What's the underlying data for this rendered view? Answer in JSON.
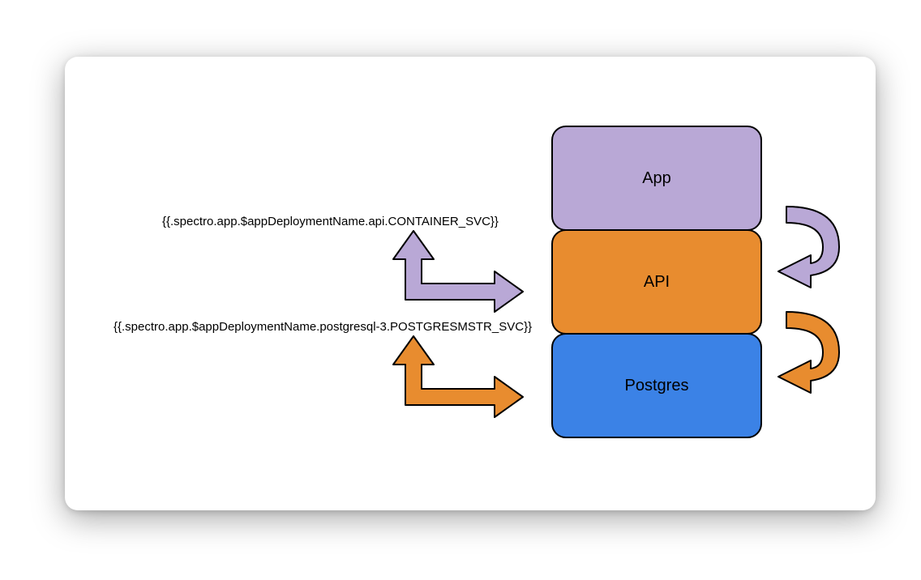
{
  "boxes": {
    "app": "App",
    "api": "API",
    "db": "Postgres"
  },
  "labels": {
    "api_svc": "{{.spectro.app.$appDeploymentName.api.CONTAINER_SVC}}",
    "pg_svc": "{{.spectro.app.$appDeploymentName.postgresql-3.POSTGRESMSTR_SVC}}"
  },
  "colors": {
    "purple": "#b9a8d6",
    "orange": "#e88c2f",
    "blue": "#3b82e6"
  }
}
